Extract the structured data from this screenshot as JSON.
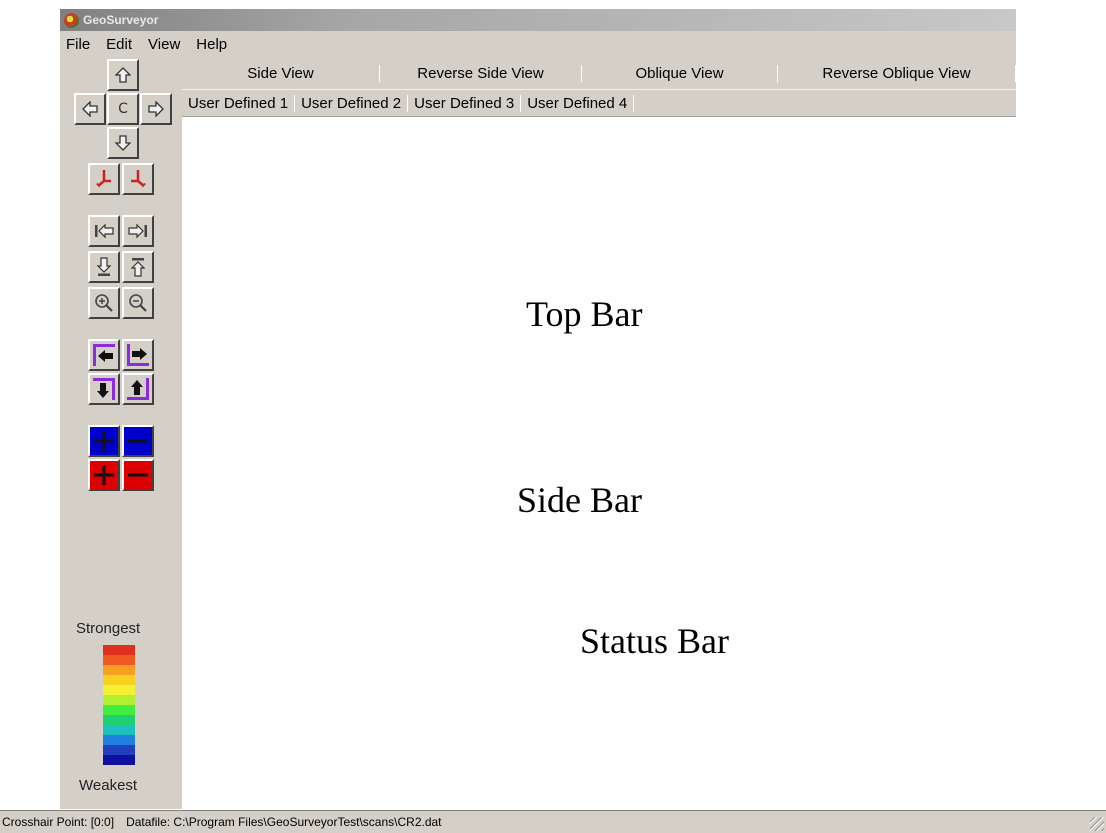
{
  "window": {
    "title": "GeoSurveyor"
  },
  "menu": [
    "File",
    "Edit",
    "View",
    "Help"
  ],
  "view_tabs": [
    "Side View",
    "Reverse Side View",
    "Oblique View",
    "Reverse Oblique View"
  ],
  "user_tabs": [
    "User Defined 1",
    "User Defined 2",
    "User Defined 3",
    "User Defined 4"
  ],
  "sidebar": {
    "center_label": "C",
    "legend_strongest": "Strongest",
    "legend_weakest": "Weakest",
    "colors": {
      "blue_button": "#0000cc",
      "red_button": "#dd0000",
      "purple_frame": "#8a2be2",
      "arrow_red": "#cc2222"
    },
    "icons": [
      "pan-up-icon",
      "pan-left-icon",
      "pan-right-icon",
      "pan-down-icon",
      "tilt-left-icon",
      "tilt-right-icon",
      "scroll-start-icon",
      "scroll-end-icon",
      "scroll-bottom-icon",
      "scroll-top-icon",
      "zoom-in-icon",
      "zoom-out-icon",
      "shift-left-icon",
      "shift-right-icon",
      "shift-down-icon",
      "shift-up-icon",
      "blue-plus-icon",
      "blue-minus-icon",
      "red-plus-icon",
      "red-minus-icon"
    ]
  },
  "color_scale": [
    "#e03020",
    "#ee5a20",
    "#f5a020",
    "#f7d020",
    "#f5f030",
    "#b0f030",
    "#40ee40",
    "#20d070",
    "#20c0c0",
    "#2080e0",
    "#2040c0",
    "#1010a0"
  ],
  "overlay_labels": [
    "Top Bar",
    "Side Bar",
    "Status Bar"
  ],
  "status": {
    "crosshair": "Crosshair Point: [0:0]",
    "datafile": "Datafile: C:\\Program Files\\GeoSurveyorTest\\scans\\CR2.dat"
  }
}
